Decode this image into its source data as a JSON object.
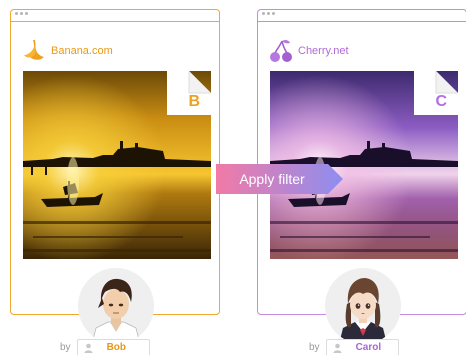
{
  "banana": {
    "site_name": "Banana.com",
    "icon": "banana-icon",
    "image_letter": "B",
    "accent": "#f0a830"
  },
  "cherry": {
    "site_name": "Cherry.net",
    "icon": "cherry-icon",
    "image_letter": "C",
    "accent": "#c58be0"
  },
  "filter_arrow": {
    "label": "Apply filter",
    "gradient": [
      "#f27aa6",
      "#8d8ef0"
    ]
  },
  "users": [
    {
      "by": "by",
      "name": "Bob",
      "icon": "user-icon"
    },
    {
      "by": "by",
      "name": "Carol",
      "icon": "user-icon"
    }
  ]
}
